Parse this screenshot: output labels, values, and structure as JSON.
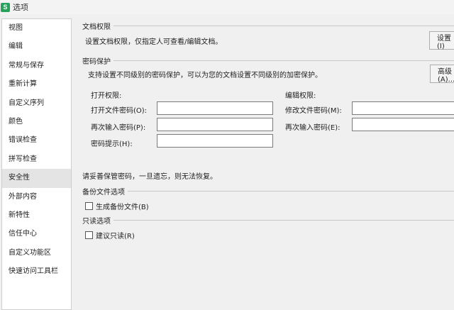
{
  "window": {
    "title": "选项",
    "icon_glyph": "S"
  },
  "sidebar": {
    "items": [
      {
        "label": "视图"
      },
      {
        "label": "编辑"
      },
      {
        "label": "常规与保存"
      },
      {
        "label": "重新计算"
      },
      {
        "label": "自定义序列"
      },
      {
        "label": "颜色"
      },
      {
        "label": "错误检查"
      },
      {
        "label": "拼写检查"
      },
      {
        "label": "安全性"
      },
      {
        "label": "外部内容"
      },
      {
        "label": "新特性"
      },
      {
        "label": "信任中心"
      },
      {
        "label": "自定义功能区"
      },
      {
        "label": "快速访问工具栏"
      }
    ],
    "selected": "安全性"
  },
  "doc_permission": {
    "title": "文档权限",
    "description": "设置文档权限，仅指定人可查看/编辑文档。",
    "button_label": "设置(I)"
  },
  "password_protection": {
    "title": "密码保护",
    "description": "支持设置不同级别的密码保护，可以为您的文档设置不同级别的加密保护。",
    "advanced_button": "高级(A)...",
    "open_permission": {
      "heading": "打开权限:",
      "open_password_label": "打开文件密码(O):",
      "open_password_value": "",
      "confirm_password_label": "再次输入密码(P):",
      "confirm_password_value": "",
      "hint_label": "密码提示(H):",
      "hint_value": ""
    },
    "edit_permission": {
      "heading": "编辑权限:",
      "modify_password_label": "修改文件密码(M):",
      "modify_password_value": "",
      "confirm_password_label": "再次输入密码(E):",
      "confirm_password_value": ""
    },
    "warning": "请妥善保管密码，一旦遗忘，则无法恢复。"
  },
  "backup": {
    "title": "备份文件选项",
    "checkbox_label": "生成备份文件(B)",
    "checked": false
  },
  "readonly": {
    "title": "只读选项",
    "checkbox_label": "建议只读(R)",
    "checked": false
  },
  "colors": {
    "app_icon": "#2aa15a",
    "selected_item_bg": "#e4e4e4",
    "window_bg": "#f0f0f0"
  }
}
